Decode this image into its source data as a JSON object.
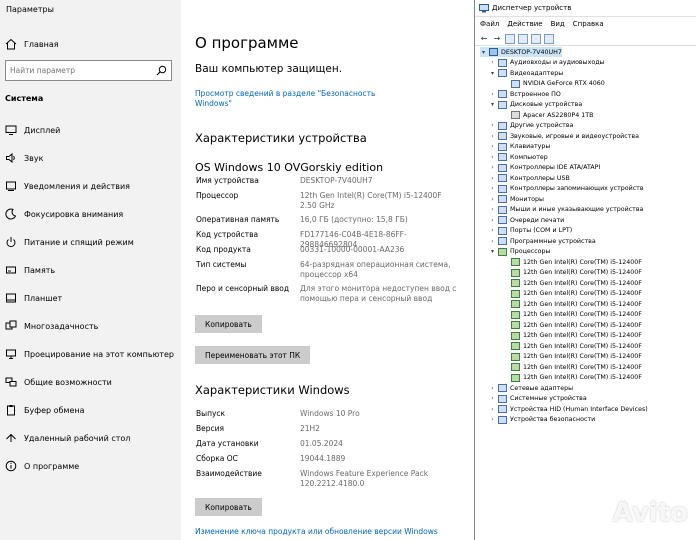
{
  "settings": {
    "window_title": "Параметры",
    "home_label": "Главная",
    "search_placeholder": "Найти параметр",
    "section": "Система",
    "nav": [
      {
        "label": "Дисплей",
        "icon": "monitor-icon"
      },
      {
        "label": "Звук",
        "icon": "speaker-icon"
      },
      {
        "label": "Уведомления и действия",
        "icon": "notification-icon"
      },
      {
        "label": "Фокусировка внимания",
        "icon": "moon-icon"
      },
      {
        "label": "Питание и спящий режим",
        "icon": "power-icon"
      },
      {
        "label": "Память",
        "icon": "storage-icon"
      },
      {
        "label": "Планшет",
        "icon": "tablet-icon"
      },
      {
        "label": "Многозадачность",
        "icon": "multitask-icon"
      },
      {
        "label": "Проецирование на этот компьютер",
        "icon": "projector-icon"
      },
      {
        "label": "Общие возможности",
        "icon": "share-icon"
      },
      {
        "label": "Буфер обмена",
        "icon": "clipboard-icon"
      },
      {
        "label": "Удаленный рабочий стол",
        "icon": "remote-icon"
      },
      {
        "label": "О программе",
        "icon": "info-icon"
      }
    ]
  },
  "about": {
    "title": "О программе",
    "protected": "Ваш компьютер защищен.",
    "security_link": "Просмотр сведений в разделе \"Безопасность Windows\"",
    "device_heading": "Характеристики устройства",
    "edition": "OS Windows 10 OVGorskiy edition",
    "device_specs": [
      {
        "key": "Имя устройства",
        "value": "DESKTOP-7V40UH7"
      },
      {
        "key": "Процессор",
        "value": "12th Gen Intel(R) Core(TM) i5-12400F 2.50 GHz"
      },
      {
        "key": "Оперативная память",
        "value": "16,0 ГБ (доступно: 15,8 ГБ)"
      },
      {
        "key": "Код устройства",
        "value": "FD177146-C04B-4E18-86FF-298846692804"
      },
      {
        "key": "Код продукта",
        "value": "00331-10000-00001-AA236"
      },
      {
        "key": "Тип системы",
        "value": "64-разрядная операционная система, процессор x64"
      },
      {
        "key": "Перо и сенсорный ввод",
        "value": "Для этого монитора недоступен ввод с помощью пера и сенсорный ввод"
      }
    ],
    "copy_label": "Копировать",
    "rename_label": "Переименовать этот ПК",
    "windows_heading": "Характеристики Windows",
    "windows_specs": [
      {
        "key": "Выпуск",
        "value": "Windows 10 Pro"
      },
      {
        "key": "Версия",
        "value": "21H2"
      },
      {
        "key": "Дата установки",
        "value": "01.05.2024"
      },
      {
        "key": "Сборка ОС",
        "value": "19044.1889"
      },
      {
        "key": "Взаимодействие",
        "value": "Windows Feature Experience Pack 120.2212.4180.0"
      }
    ],
    "copy2_label": "Копировать",
    "bottom_link": "Изменение ключа продукта или обновление версии Windows"
  },
  "device_manager": {
    "title": "Диспетчер устройств",
    "menu": [
      "Файл",
      "Действие",
      "Вид",
      "Справка"
    ],
    "tree": [
      {
        "label": "DESKTOP-7V40UH7",
        "level": 0,
        "exp": "v",
        "kind": "root"
      },
      {
        "label": "Аудиовходы и аудиовыходы",
        "level": 1,
        "exp": ">"
      },
      {
        "label": "Видеоадаптеры",
        "level": 1,
        "exp": "v"
      },
      {
        "label": "NVIDIA GeForce RTX 4060",
        "level": 2,
        "exp": ""
      },
      {
        "label": "Встроенное ПО",
        "level": 1,
        "exp": ">"
      },
      {
        "label": "Дисковые устройства",
        "level": 1,
        "exp": "v"
      },
      {
        "label": "Apacer AS2280P4 1TB",
        "level": 2,
        "exp": "",
        "kind": "disk"
      },
      {
        "label": "Другие устройства",
        "level": 1,
        "exp": ">"
      },
      {
        "label": "Звуковые, игровые и видеоустройства",
        "level": 1,
        "exp": ">"
      },
      {
        "label": "Клавиатуры",
        "level": 1,
        "exp": ">"
      },
      {
        "label": "Компьютер",
        "level": 1,
        "exp": ">"
      },
      {
        "label": "Контроллеры IDE ATA/ATAPI",
        "level": 1,
        "exp": ">"
      },
      {
        "label": "Контроллеры USB",
        "level": 1,
        "exp": ">"
      },
      {
        "label": "Контроллеры запоминающих устройств",
        "level": 1,
        "exp": ">"
      },
      {
        "label": "Мониторы",
        "level": 1,
        "exp": ">"
      },
      {
        "label": "Мыши и иные указывающие устройства",
        "level": 1,
        "exp": ">"
      },
      {
        "label": "Очереди печати",
        "level": 1,
        "exp": ">"
      },
      {
        "label": "Порты (COM и LPT)",
        "level": 1,
        "exp": ">"
      },
      {
        "label": "Программные устройства",
        "level": 1,
        "exp": ">"
      },
      {
        "label": "Процессоры",
        "level": 1,
        "exp": "v",
        "kind": "cpu"
      },
      {
        "label": "12th Gen Intel(R) Core(TM) i5-12400F",
        "level": 2,
        "exp": "",
        "kind": "cpu"
      },
      {
        "label": "12th Gen Intel(R) Core(TM) i5-12400F",
        "level": 2,
        "exp": "",
        "kind": "cpu"
      },
      {
        "label": "12th Gen Intel(R) Core(TM) i5-12400F",
        "level": 2,
        "exp": "",
        "kind": "cpu"
      },
      {
        "label": "12th Gen Intel(R) Core(TM) i5-12400F",
        "level": 2,
        "exp": "",
        "kind": "cpu"
      },
      {
        "label": "12th Gen Intel(R) Core(TM) i5-12400F",
        "level": 2,
        "exp": "",
        "kind": "cpu"
      },
      {
        "label": "12th Gen Intel(R) Core(TM) i5-12400F",
        "level": 2,
        "exp": "",
        "kind": "cpu"
      },
      {
        "label": "12th Gen Intel(R) Core(TM) i5-12400F",
        "level": 2,
        "exp": "",
        "kind": "cpu"
      },
      {
        "label": "12th Gen Intel(R) Core(TM) i5-12400F",
        "level": 2,
        "exp": "",
        "kind": "cpu"
      },
      {
        "label": "12th Gen Intel(R) Core(TM) i5-12400F",
        "level": 2,
        "exp": "",
        "kind": "cpu"
      },
      {
        "label": "12th Gen Intel(R) Core(TM) i5-12400F",
        "level": 2,
        "exp": "",
        "kind": "cpu"
      },
      {
        "label": "12th Gen Intel(R) Core(TM) i5-12400F",
        "level": 2,
        "exp": "",
        "kind": "cpu"
      },
      {
        "label": "12th Gen Intel(R) Core(TM) i5-12400F",
        "level": 2,
        "exp": "",
        "kind": "cpu"
      },
      {
        "label": "Сетевые адаптеры",
        "level": 1,
        "exp": ">"
      },
      {
        "label": "Системные устройства",
        "level": 1,
        "exp": ">"
      },
      {
        "label": "Устройства HID (Human Interface Devices)",
        "level": 1,
        "exp": ">"
      },
      {
        "label": "Устройства безопасности",
        "level": 1,
        "exp": ">"
      }
    ]
  },
  "watermark": "Avito"
}
